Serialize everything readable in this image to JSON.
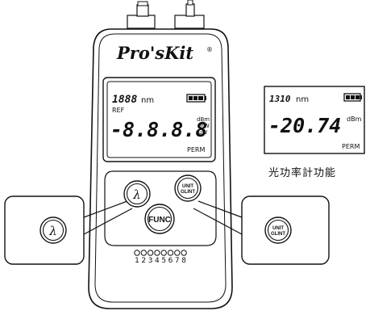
{
  "device": {
    "brand": "Pro'sKit",
    "brand_mark": "®",
    "display": {
      "wavelength": "1888",
      "wavelength_unit": "nm",
      "ref_label": "REF",
      "main_value": "-8.8.8.8",
      "units": [
        "dBm",
        "mW",
        "uW"
      ],
      "mode": "PERM",
      "battery_icon": "battery-icon"
    },
    "buttons": {
      "lambda": "λ",
      "func": "FUNC",
      "unit_line1": "UNIT",
      "unit_line2": "GLINT"
    },
    "leds": {
      "count": 8,
      "labels": [
        "1",
        "2",
        "3",
        "4",
        "5",
        "6",
        "7",
        "8"
      ]
    }
  },
  "callouts": {
    "left_button": "λ",
    "right_button_line1": "UNIT",
    "right_button_line2": "GLINT"
  },
  "example_display": {
    "wavelength": "1310",
    "wavelength_unit": "nm",
    "value": "-20.74",
    "unit": "dBm",
    "mode": "PERM",
    "battery_icon": "battery-icon"
  },
  "caption": "光功率計功能"
}
